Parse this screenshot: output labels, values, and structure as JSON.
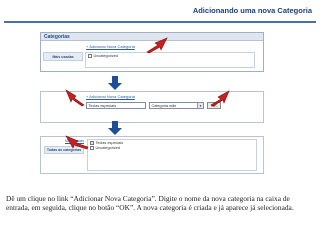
{
  "slide": {
    "title": "Adicionando uma nova Categoria"
  },
  "panel_top": {
    "header": "Categorias",
    "add_link": "+ Adicionar Nova Categoria",
    "tab_label": "Mais usadas",
    "items": [
      "Uncategorized"
    ]
  },
  "panel_middle": {
    "add_link": "+ Adicionar Nova Categoria",
    "input_value": "Teclas especiais",
    "select_value": "Categoria mãe",
    "ok_label": "OK"
  },
  "panel_bottom": {
    "left_link": "Mais usadas",
    "all_categories_label": "Todas as categorias",
    "items": [
      "Teclas especiais",
      "Uncategorized"
    ]
  },
  "caption": "Dê um clique no link “Adicionar Nova Categoria”. Digite o nome da nova categoria na caixa de entrada, em seguida, clique no botão “OK”. A nova categoria é criada e já aparece já selecionada.",
  "colors": {
    "title": "#1f3f7a",
    "rule": "#4b6db1",
    "blue_arrow": "#1e4e9a",
    "red_arrow": "#c8201e"
  }
}
